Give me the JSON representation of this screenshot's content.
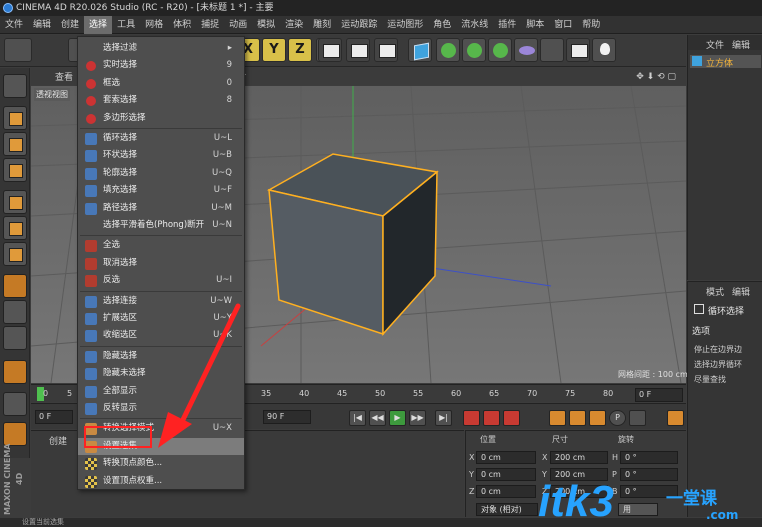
{
  "window": {
    "title": "CINEMA 4D R20.026 Studio (RC - R20) - [未标题 1 *] - 主要"
  },
  "menubar": {
    "items": [
      "文件",
      "编辑",
      "创建",
      "选择",
      "工具",
      "网格",
      "体积",
      "捕捉",
      "动画",
      "模拟",
      "渲染",
      "雕刻",
      "运动跟踪",
      "运动图形",
      "角色",
      "流水线",
      "插件",
      "脚本",
      "窗口",
      "帮助"
    ],
    "active_index": 3
  },
  "toolbar": {
    "axis_x": "X",
    "axis_y": "Y",
    "axis_z": "Z"
  },
  "viewport": {
    "tab_view": "查看",
    "label": "透视视图",
    "camera_suffix": "der",
    "grid_readout": "网格间距 : 100 cm"
  },
  "timeline": {
    "ticks": [
      "0",
      "5",
      "35",
      "40",
      "45",
      "50",
      "55",
      "60",
      "65",
      "70",
      "75",
      "80",
      "85",
      "90"
    ],
    "start_field": "0 F",
    "end_field": "90 F",
    "current_field": "0 F"
  },
  "material_panel": {
    "menu_create": "创建"
  },
  "coords": {
    "headers": [
      "位置",
      "尺寸",
      "旋转"
    ],
    "rows": [
      {
        "axis": "X",
        "pos": "0 cm",
        "size_axis": "X",
        "size": "200 cm",
        "rot_axis": "H",
        "rot": "0 °"
      },
      {
        "axis": "Y",
        "pos": "0 cm",
        "size_axis": "Y",
        "size": "200 cm",
        "rot_axis": "P",
        "rot": "0 °"
      },
      {
        "axis": "Z",
        "pos": "0 cm",
        "size_axis": "Z",
        "size": "200 cm",
        "rot_axis": "B",
        "rot": "0 °"
      }
    ],
    "mode_select": "对象 (相对)",
    "apply_label": "用"
  },
  "object_manager": {
    "tabs": [
      "文件",
      "编辑"
    ],
    "object_name": "立方体"
  },
  "attribute_manager": {
    "tab_mode": "模式",
    "tab_edit": "编辑",
    "tool_title": "循环选择",
    "section": "选项",
    "options": [
      "停止在边界边",
      "选择边界循环",
      "尽量查找"
    ]
  },
  "statusbar": {
    "text": "设置当前选集"
  },
  "branding": {
    "logo": "MAXON CINEMA 4D"
  },
  "watermark": {
    "text": "itk3",
    "sub": "一堂课",
    "domain": ".com"
  },
  "select_menu": {
    "items": [
      {
        "label": "选择过滤",
        "shortcut": "",
        "icon": "none",
        "submenu": true
      },
      {
        "label": "实时选择",
        "shortcut": "9",
        "icon": "brush"
      },
      {
        "label": "框选",
        "shortcut": "0",
        "icon": "brush"
      },
      {
        "label": "套索选择",
        "shortcut": "8",
        "icon": "brush"
      },
      {
        "label": "多边形选择",
        "shortcut": "",
        "icon": "brush"
      },
      {
        "label": "循环选择",
        "shortcut": "U~L",
        "icon": "blue"
      },
      {
        "label": "环状选择",
        "shortcut": "U~B",
        "icon": "blue"
      },
      {
        "label": "轮廓选择",
        "shortcut": "U~Q",
        "icon": "blue"
      },
      {
        "label": "填充选择",
        "shortcut": "U~F",
        "icon": "blue"
      },
      {
        "label": "路径选择",
        "shortcut": "U~M",
        "icon": "blue"
      },
      {
        "label": "选择平滑着色(Phong)断开",
        "shortcut": "U~N",
        "icon": "none"
      },
      {
        "label": "全选",
        "shortcut": "",
        "icon": "red"
      },
      {
        "label": "取消选择",
        "shortcut": "",
        "icon": "red"
      },
      {
        "label": "反选",
        "shortcut": "U~I",
        "icon": "red"
      },
      {
        "label": "选择连接",
        "shortcut": "U~W",
        "icon": "blue"
      },
      {
        "label": "扩展选区",
        "shortcut": "U~Y",
        "icon": "blue"
      },
      {
        "label": "收缩选区",
        "shortcut": "U~K",
        "icon": "blue"
      },
      {
        "label": "隐藏选择",
        "shortcut": "",
        "icon": "blue"
      },
      {
        "label": "隐藏未选择",
        "shortcut": "",
        "icon": "blue"
      },
      {
        "label": "全部显示",
        "shortcut": "",
        "icon": "blue"
      },
      {
        "label": "反转显示",
        "shortcut": "",
        "icon": "blue"
      },
      {
        "label": "转换选择模式",
        "shortcut": "U~X",
        "icon": "orange"
      },
      {
        "label": "设置选集",
        "shortcut": "",
        "icon": "orange"
      },
      {
        "label": "转换顶点颜色...",
        "shortcut": "",
        "icon": "checker"
      },
      {
        "label": "设置顶点权重...",
        "shortcut": "",
        "icon": "checker"
      }
    ]
  },
  "colors": {
    "accent_selection": "#ffb020",
    "annotation_red": "#ff2222",
    "axis_yellow": "#d8c049"
  }
}
